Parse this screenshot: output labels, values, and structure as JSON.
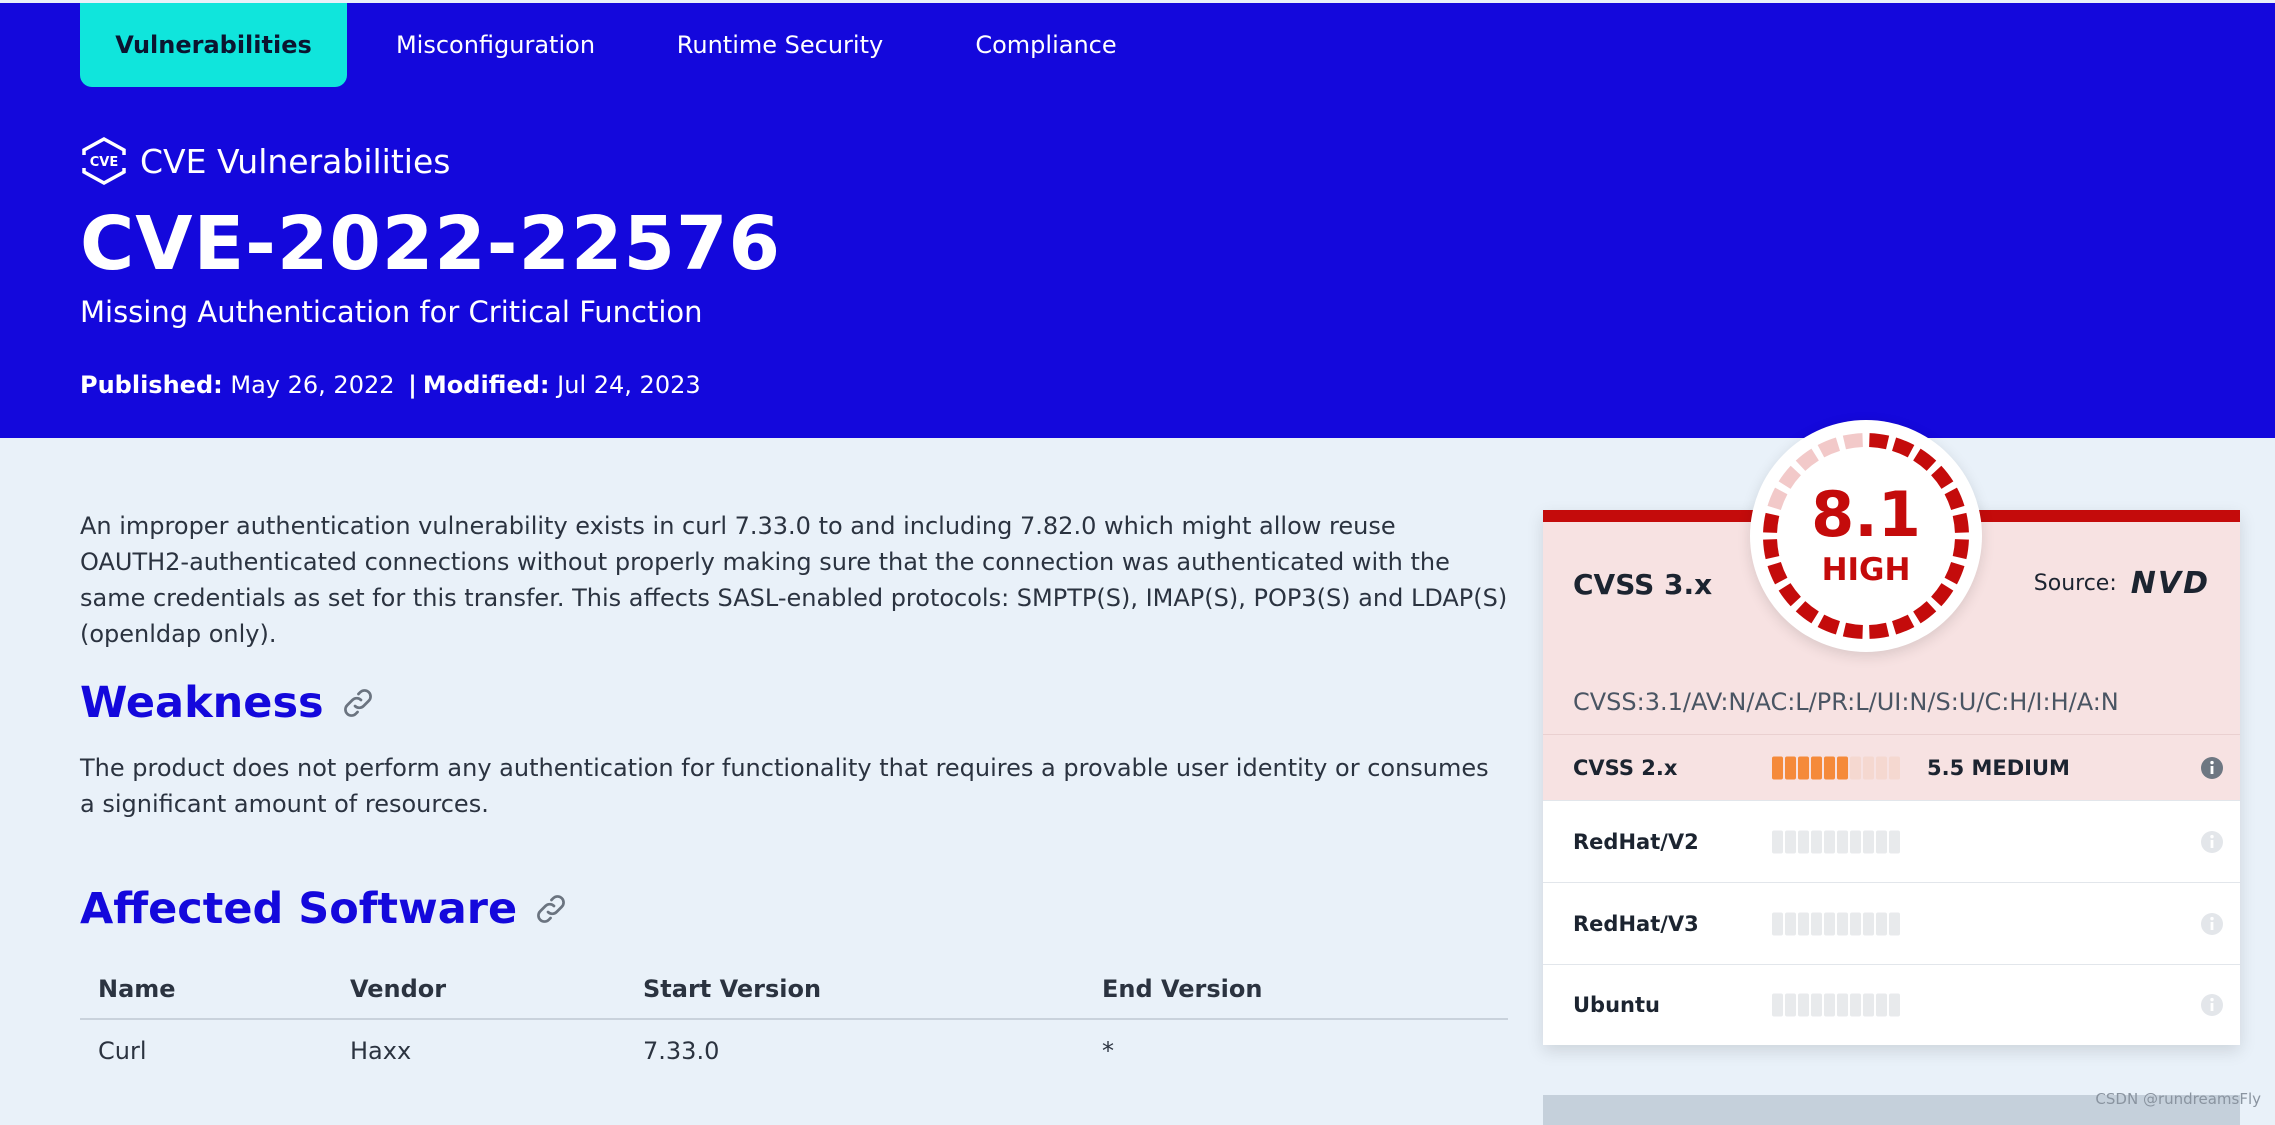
{
  "nav": {
    "tabs": [
      {
        "label": "Vulnerabilities",
        "active": true
      },
      {
        "label": "Misconfiguration",
        "active": false
      },
      {
        "label": "Runtime Security",
        "active": false
      },
      {
        "label": "Compliance",
        "active": false
      }
    ]
  },
  "header": {
    "kicker": "CVE Vulnerabilities",
    "title": "CVE-2022-22576",
    "subtitle": "Missing Authentication for Critical Function",
    "published_label": "Published:",
    "published_value": "May 26, 2022",
    "separator": "|",
    "modified_label": "Modified:",
    "modified_value": "Jul 24, 2023"
  },
  "description": "An improper authentication vulnerability exists in curl 7.33.0 to and including 7.82.0 which might allow reuse OAUTH2-authenticated connections without properly making sure that the connection was authenticated with the same credentials as set for this transfer. This affects SASL-enabled protocols: SMPTP(S), IMAP(S), POP3(S) and LDAP(S) (openldap only).",
  "weakness": {
    "heading": "Weakness",
    "text": "The product does not perform any authentication for functionality that requires a provable user identity or consumes a significant amount of resources."
  },
  "affected": {
    "heading": "Affected Software",
    "columns": [
      "Name",
      "Vendor",
      "Start Version",
      "End Version"
    ],
    "rows": [
      [
        "Curl",
        "Haxx",
        "7.33.0",
        "*"
      ]
    ]
  },
  "score_card": {
    "primary": {
      "label": "CVSS 3.x",
      "score": "8.1",
      "severity": "HIGH",
      "source_label": "Source:",
      "source_name": "NVD",
      "vector": "CVSS:3.1/AV:N/AC:L/PR:L/UI:N/S:U/C:H/I:H/A:N",
      "score_fraction": 0.81
    },
    "rows": [
      {
        "label": "CVSS 2.x",
        "score_text": "5.5 MEDIUM",
        "filled_segments": 5.5,
        "total_segments": 10
      },
      {
        "label": "RedHat/V2",
        "score_text": "",
        "filled_segments": 0,
        "total_segments": 10
      },
      {
        "label": "RedHat/V3",
        "score_text": "",
        "filled_segments": 0,
        "total_segments": 10
      },
      {
        "label": "Ubuntu",
        "score_text": "",
        "filled_segments": 0,
        "total_segments": 10
      }
    ]
  },
  "colors": {
    "hero_bg": "#1408dc",
    "active_tab": "#10e5dc",
    "high": "#c40b0b",
    "medium_bar": "#f58a3a",
    "heading": "#1408dc"
  },
  "watermark": "CSDN @rundreamsFly"
}
